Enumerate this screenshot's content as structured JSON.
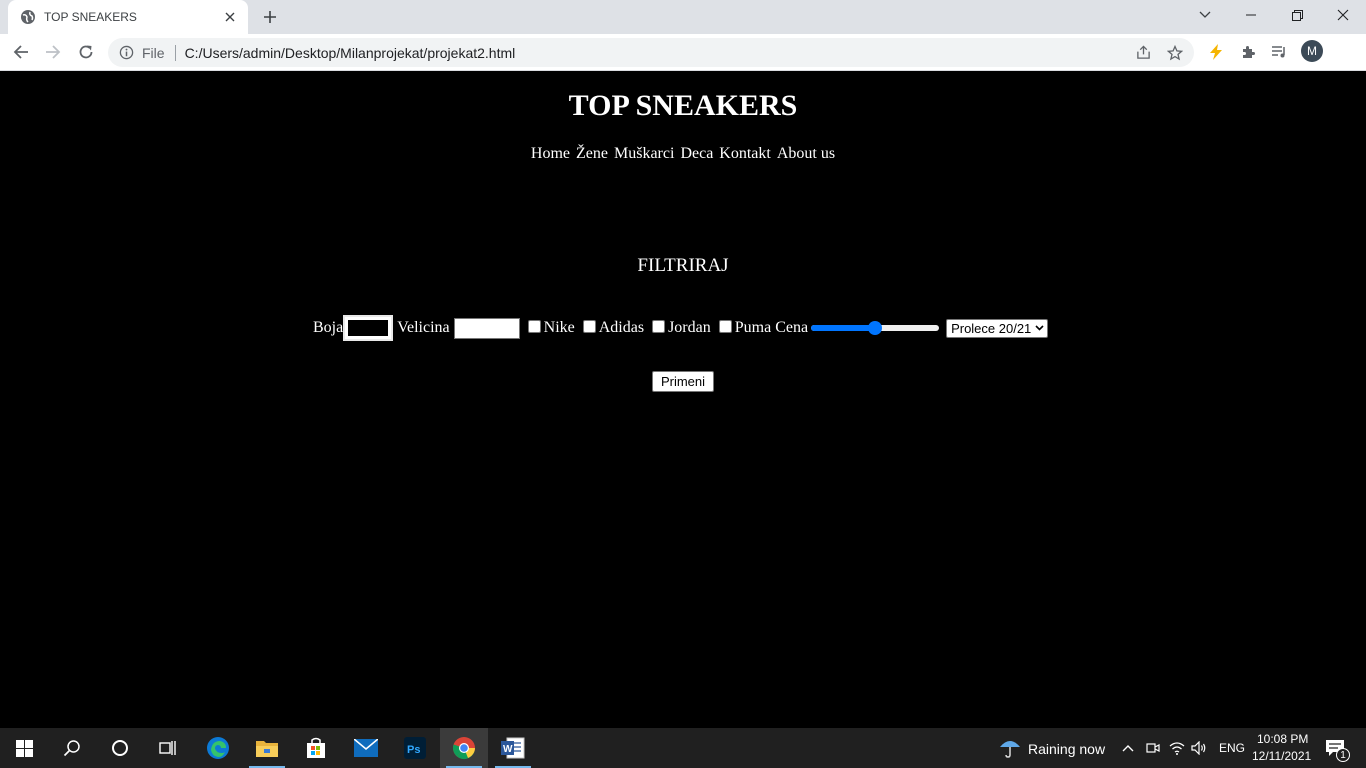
{
  "browser": {
    "tab_title": "TOP SNEAKERS",
    "url_scheme": "File",
    "url": "C:/Users/admin/Desktop/Milanprojekat/projekat2.html",
    "profile_initial": "M"
  },
  "page": {
    "heading": "TOP SNEAKERS",
    "nav": [
      "Home",
      "Žene",
      "Muškarci",
      "Deca",
      "Kontakt",
      "About us"
    ],
    "filter_title": "FILTRIRAJ",
    "filters": {
      "color_label": "Boja",
      "color_value": "#000000",
      "size_label": "Velicina",
      "brands": [
        "Nike",
        "Adidas",
        "Jordan",
        "Puma"
      ],
      "price_label": "Cena",
      "price_fraction": 0.5,
      "season_selected": "Prolece 20/21"
    },
    "apply_label": "Primeni"
  },
  "taskbar": {
    "apps": [
      "start-icon",
      "search-icon",
      "cortana-icon",
      "task-view-icon",
      "edge-icon",
      "file-explorer-icon",
      "store-icon",
      "mail-icon",
      "photoshop-icon",
      "chrome-icon",
      "word-icon"
    ],
    "weather_text": "Raining now",
    "language": "ENG",
    "time": "10:08 PM",
    "date": "12/11/2021",
    "notification_count": "1"
  },
  "colors": {
    "page_bg": "#000000",
    "accent_blue": "#0075ff",
    "taskbar_bg": "#202020",
    "tabstrip_bg": "#dee1e6"
  }
}
